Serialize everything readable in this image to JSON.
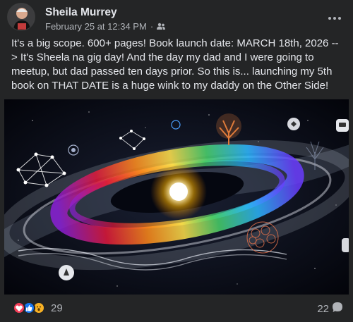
{
  "post": {
    "author": "Sheila Murrey",
    "timestamp": "February 25 at 12:34 PM",
    "separator": "·",
    "audience_icon": "friends-icon",
    "more_icon": "more-icon",
    "text": "It's a big scope. 600+ pages! Book launch date: MARCH 18th, 2026 --> It's Sheela na gig day! And the day my dad and I were going to meetup, but dad passed ten days prior. So this is... launching my 5th book on THAT DATE is a huge wink to my daddy on the Other Side!"
  },
  "reactions": {
    "icons": [
      "love-icon",
      "like-icon",
      "wow-icon"
    ],
    "count": "29"
  },
  "comments": {
    "count": "22",
    "icon": "comment-icon"
  },
  "colors": {
    "background": "#242526",
    "text_primary": "#e4e6eb",
    "text_secondary": "#b0b3b8",
    "love": "#f33e58",
    "like": "#1877f2",
    "wow": "#f7b125"
  }
}
